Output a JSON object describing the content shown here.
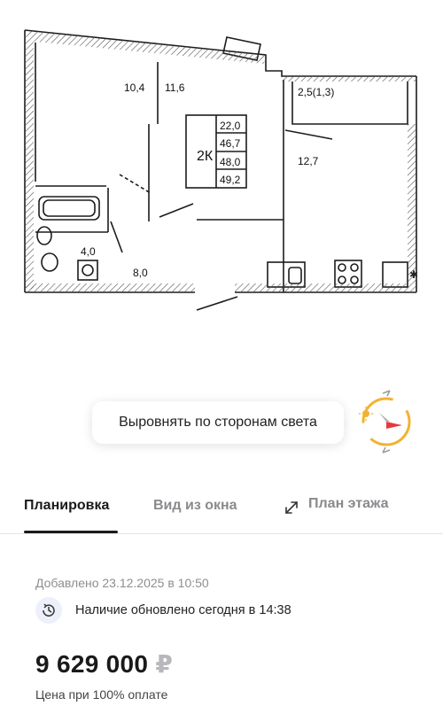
{
  "plan": {
    "label": "2К",
    "areas": [
      "22,0",
      "46,7",
      "48,0",
      "49,2"
    ],
    "rooms": {
      "room_a": "10,4",
      "room_b": "11,6",
      "balcony": "2,5(1,3)",
      "kitchen": "12,7",
      "bath": "4,0",
      "hall": "8,0"
    }
  },
  "orientation": {
    "label": "Выровнять по сторонам света",
    "icon": "compass-icon"
  },
  "tabs": [
    {
      "label": "Планировка"
    },
    {
      "label": "Вид из окна"
    },
    {
      "label": "План этажа"
    }
  ],
  "info": {
    "added": "Добавлено 23.12.2025 в 10:50",
    "availability": "Наличие обновлено сегодня в 14:38",
    "price_value": "9 629 000",
    "currency": "₽",
    "price_note": "Цена при 100% оплате"
  },
  "colors": {
    "accent_red": "#e8383d",
    "sun_yellow": "#f3b232"
  }
}
